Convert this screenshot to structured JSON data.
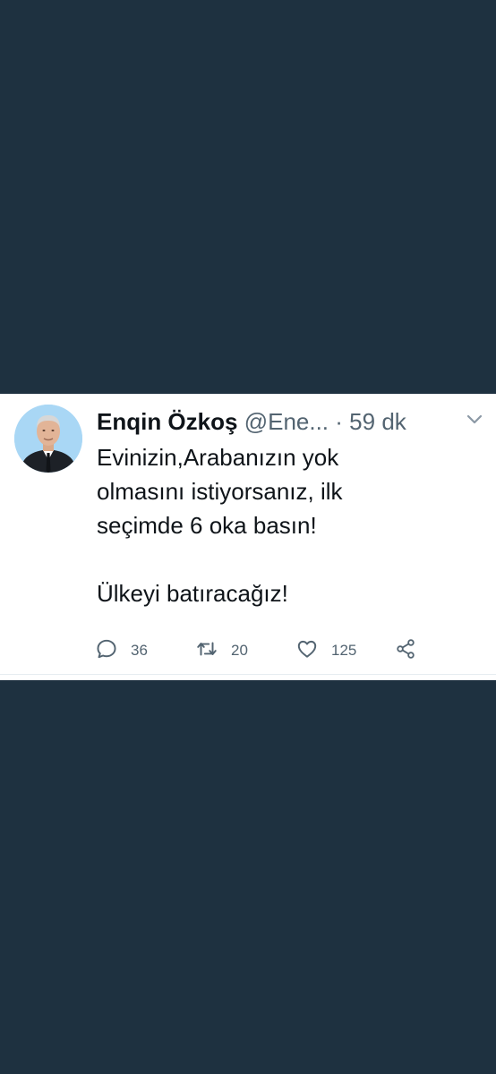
{
  "tweet": {
    "display_name": "Enqin Özkoş",
    "handle": "@Ene...",
    "separator": "·",
    "time": "59 dk",
    "text": "Evinizin,Arabanızın yok\nolmasını istiyorsanız, ilk\nseçimde 6 oka basın!\n\nÜlkeyi batıracağız!",
    "avatar_icon": "profile-photo",
    "more_icon": "chevron-down-icon"
  },
  "actions": {
    "reply": {
      "icon": "reply-icon",
      "count": "36"
    },
    "retweet": {
      "icon": "retweet-icon",
      "count": "20"
    },
    "like": {
      "icon": "heart-icon",
      "count": "125"
    },
    "share": {
      "icon": "share-icon"
    }
  },
  "colors": {
    "background": "#1e3140",
    "card": "#ffffff",
    "text_primary": "#0f1419",
    "text_secondary": "#536471"
  }
}
